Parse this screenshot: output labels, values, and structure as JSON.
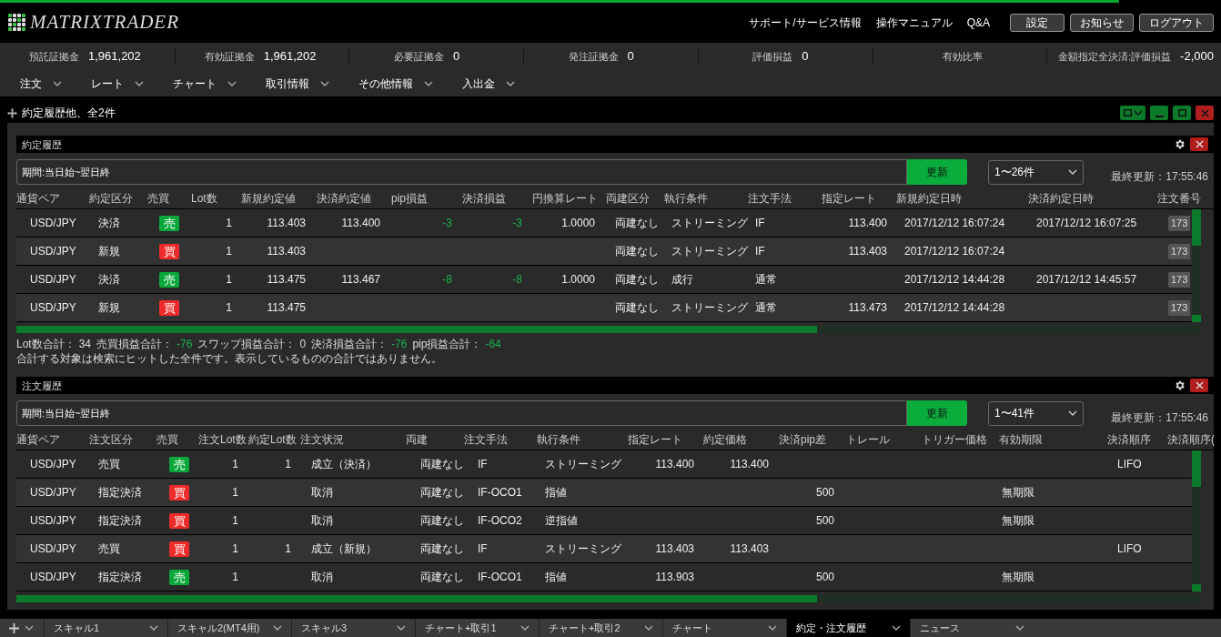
{
  "header": {
    "logo": "MATRIXTRADER",
    "links": [
      "サポート/サービス情報",
      "操作マニュアル",
      "Q&A"
    ],
    "buttons": [
      "設定",
      "お知らせ",
      "ログアウト"
    ]
  },
  "summary": [
    {
      "label": "預託証拠金",
      "value": "1,961,202"
    },
    {
      "label": "有効証拠金",
      "value": "1,961,202"
    },
    {
      "label": "必要証拠金",
      "value": "0"
    },
    {
      "label": "発注証拠金",
      "value": "0"
    },
    {
      "label": "評価損益",
      "value": "0"
    },
    {
      "label": "有効比率"
    },
    {
      "label": "金額指定全決済:評価損益",
      "value": "-2,000"
    }
  ],
  "menu": [
    "注文",
    "レート",
    "チャート",
    "取引情報",
    "その他情報",
    "入出金"
  ],
  "window": {
    "title": "約定履歴他、全2件"
  },
  "panels": [
    {
      "title": "約定履歴",
      "filter": "期間:当日始~翌日終",
      "refresh": "更新",
      "range": "1〜26件",
      "updated": "最終更新：17:55:46",
      "columns": [
        {
          "label": "通貨ペア"
        },
        {
          "label": "約定区分"
        },
        {
          "label": "売買"
        },
        {
          "label": "Lot数"
        },
        {
          "label": "新規約定値"
        },
        {
          "label": "決済約定値"
        },
        {
          "label": "pip損益"
        },
        {
          "label": "決済損益"
        },
        {
          "label": "円換算レート"
        },
        {
          "label": "両建区分"
        },
        {
          "label": "執行条件"
        },
        {
          "label": "注文手法"
        },
        {
          "label": "指定レート"
        },
        {
          "label": "新規約定日時"
        },
        {
          "label": "決済約定日時"
        },
        {
          "label": "注文番号",
          "sortable": true
        }
      ],
      "rows": [
        {
          "pair": "USD/JPY",
          "type": "決済",
          "side": {
            "text": "売",
            "kind": "sell"
          },
          "lot": "1",
          "open": "113.403",
          "close": "113.400",
          "pip": {
            "text": "-3",
            "kind": "negative"
          },
          "pnl": {
            "text": "-3",
            "kind": "negative"
          },
          "rate": "1.0000",
          "hedge": "両建なし",
          "exec": "ストリーミング",
          "method": "IF",
          "limit": "113.400",
          "opened": "2017/12/12 16:07:24",
          "closed": "2017/12/12 16:07:25",
          "order": {
            "text": "173",
            "kind": "badge"
          }
        },
        {
          "pair": "USD/JPY",
          "type": "新規",
          "side": {
            "text": "買",
            "kind": "buy"
          },
          "lot": "1",
          "open": "113.403",
          "hedge": "両建なし",
          "exec": "ストリーミング",
          "method": "IF",
          "limit": "113.403",
          "opened": "2017/12/12 16:07:24",
          "order": {
            "text": "173",
            "kind": "badge"
          }
        },
        {
          "pair": "USD/JPY",
          "type": "決済",
          "side": {
            "text": "売",
            "kind": "sell"
          },
          "lot": "1",
          "open": "113.475",
          "close": "113.467",
          "pip": {
            "text": "-8",
            "kind": "negative"
          },
          "pnl": {
            "text": "-8",
            "kind": "negative"
          },
          "rate": "1.0000",
          "hedge": "両建なし",
          "exec": "成行",
          "method": "通常",
          "opened": "2017/12/12 14:44:28",
          "closed": "2017/12/12 14:45:57",
          "order": {
            "text": "173",
            "kind": "badge"
          }
        },
        {
          "pair": "USD/JPY",
          "type": "新規",
          "side": {
            "text": "買",
            "kind": "buy"
          },
          "lot": "1",
          "open": "113.475",
          "hedge": "両建なし",
          "exec": "ストリーミング",
          "method": "通常",
          "limit": "113.473",
          "opened": "2017/12/12 14:44:28",
          "order": {
            "text": "173",
            "kind": "badge"
          }
        }
      ],
      "totals": [
        {
          "label": "Lot数合計：",
          "value": "34"
        },
        {
          "label": "売買損益合計：",
          "value": "-76",
          "kind": "negative"
        },
        {
          "label": "スワップ損益合計：",
          "value": "0"
        },
        {
          "label": "決済損益合計：",
          "value": "-76",
          "kind": "negative"
        },
        {
          "label": "pip損益合計：",
          "value": "-64",
          "kind": "negative"
        }
      ],
      "note": "合計する対象は検索にヒットした全件です。表示しているものの合計ではありません。"
    },
    {
      "title": "注文履歴",
      "filter": "期間:当日始~翌日終",
      "refresh": "更新",
      "range": "1〜41件",
      "updated": "最終更新：17:55:46",
      "columns": [
        {
          "label": "通貨ペア"
        },
        {
          "label": "注文区分"
        },
        {
          "label": "売買"
        },
        {
          "label": "注文Lot数"
        },
        {
          "label": "約定Lot数"
        },
        {
          "label": "注文状況"
        },
        {
          "label": "両建"
        },
        {
          "label": "注文手法"
        },
        {
          "label": "執行条件"
        },
        {
          "label": "指定レート"
        },
        {
          "label": "約定価格"
        },
        {
          "label": "決済pip差"
        },
        {
          "label": "トレール"
        },
        {
          "label": "トリガー価格"
        },
        {
          "label": "有効期限"
        },
        {
          "label": "決済順序"
        },
        {
          "label": "決済順序("
        }
      ],
      "rows": [
        {
          "pair": "USD/JPY",
          "type": "売買",
          "side": {
            "text": "売",
            "kind": "sell"
          },
          "olot": "1",
          "flot": "1",
          "status": "成立（決済）",
          "hedge": "両建なし",
          "method": "IF",
          "exec": "ストリーミング",
          "limit": "113.400",
          "price": "113.400",
          "order": "LIFO"
        },
        {
          "pair": "USD/JPY",
          "type": "指定決済",
          "side": {
            "text": "買",
            "kind": "buy"
          },
          "olot": "1",
          "status": "取消",
          "hedge": "両建なし",
          "method": "IF-OCO1",
          "exec": "指値",
          "pipdiff": "500",
          "expiry": "無期限"
        },
        {
          "pair": "USD/JPY",
          "type": "指定決済",
          "side": {
            "text": "買",
            "kind": "buy"
          },
          "olot": "1",
          "status": "取消",
          "hedge": "両建なし",
          "method": "IF-OCO2",
          "exec": "逆指値",
          "pipdiff": "500",
          "expiry": "無期限"
        },
        {
          "pair": "USD/JPY",
          "type": "売買",
          "side": {
            "text": "買",
            "kind": "buy"
          },
          "olot": "1",
          "flot": "1",
          "status": "成立（新規）",
          "hedge": "両建なし",
          "method": "IF",
          "exec": "ストリーミング",
          "limit": "113.403",
          "price": "113.403",
          "order": "LIFO"
        },
        {
          "pair": "USD/JPY",
          "type": "指定決済",
          "side": {
            "text": "売",
            "kind": "sell"
          },
          "olot": "1",
          "status": "取消",
          "hedge": "両建なし",
          "method": "IF-OCO1",
          "exec": "指値",
          "limit": "113.903",
          "pipdiff": "500",
          "expiry": "無期限"
        }
      ]
    }
  ],
  "tabs": [
    {
      "label": "スキャル1",
      "selected": false
    },
    {
      "label": "スキャル2(MT4用)",
      "selected": false
    },
    {
      "label": "スキャル3",
      "selected": false
    },
    {
      "label": "チャート+取引1",
      "selected": false
    },
    {
      "label": "チャート+取引2",
      "selected": false
    },
    {
      "label": "チャート",
      "selected": false
    },
    {
      "label": "約定・注文履歴",
      "selected": true
    },
    {
      "label": "ニュース",
      "selected": false
    }
  ]
}
